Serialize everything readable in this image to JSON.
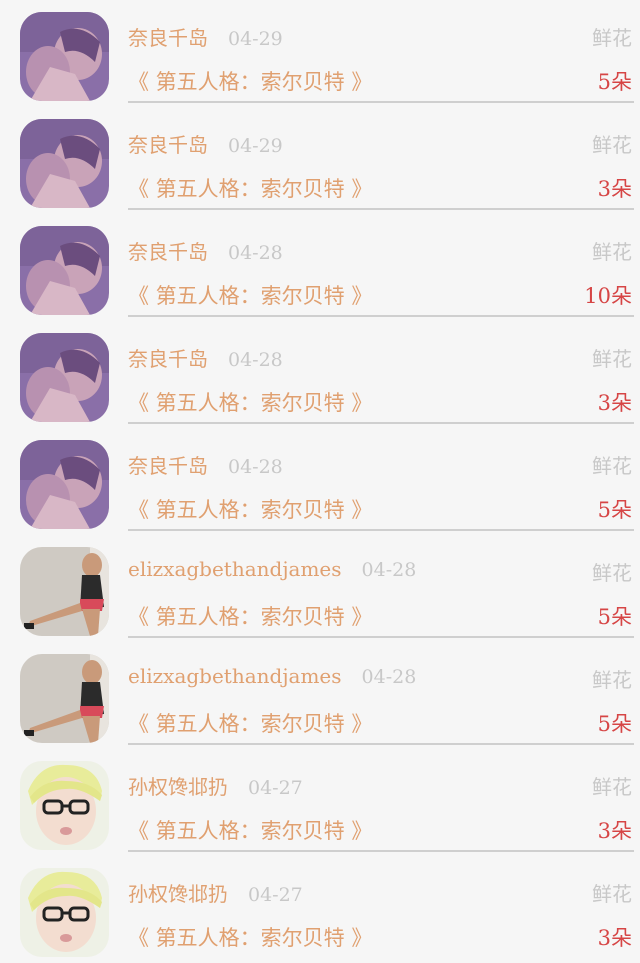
{
  "list": {
    "items": [
      {
        "name": "奈良千岛",
        "date": "04-29",
        "gift": "鲜花",
        "title": "《 第五人格：索尔贝特 》",
        "count": "5朵",
        "avatar": "avatar-purple"
      },
      {
        "name": "奈良千岛",
        "date": "04-29",
        "gift": "鲜花",
        "title": "《 第五人格：索尔贝特 》",
        "count": "3朵",
        "avatar": "avatar-purple"
      },
      {
        "name": "奈良千岛",
        "date": "04-28",
        "gift": "鲜花",
        "title": "《 第五人格：索尔贝特 》",
        "count": "10朵",
        "avatar": "avatar-purple"
      },
      {
        "name": "奈良千岛",
        "date": "04-28",
        "gift": "鲜花",
        "title": "《 第五人格：索尔贝特 》",
        "count": "3朵",
        "avatar": "avatar-purple"
      },
      {
        "name": "奈良千岛",
        "date": "04-28",
        "gift": "鲜花",
        "title": "《 第五人格：索尔贝特 》",
        "count": "5朵",
        "avatar": "avatar-purple"
      },
      {
        "name": "elizxagbethandjames",
        "date": "04-28",
        "gift": "鲜花",
        "title": "《 第五人格：索尔贝特 》",
        "count": "5朵",
        "avatar": "avatar-athlete"
      },
      {
        "name": "elizxagbethandjames",
        "date": "04-28",
        "gift": "鲜花",
        "title": "《 第五人格：索尔贝特 》",
        "count": "5朵",
        "avatar": "avatar-athlete"
      },
      {
        "name": "孙权馋邶扔",
        "date": "04-27",
        "gift": "鲜花",
        "title": "《 第五人格：索尔贝特 》",
        "count": "3朵",
        "avatar": "avatar-glasses"
      },
      {
        "name": "孙权馋邶扔",
        "date": "04-27",
        "gift": "鲜花",
        "title": "《 第五人格：索尔贝特 》",
        "count": "3朵",
        "avatar": "avatar-glasses"
      }
    ]
  }
}
